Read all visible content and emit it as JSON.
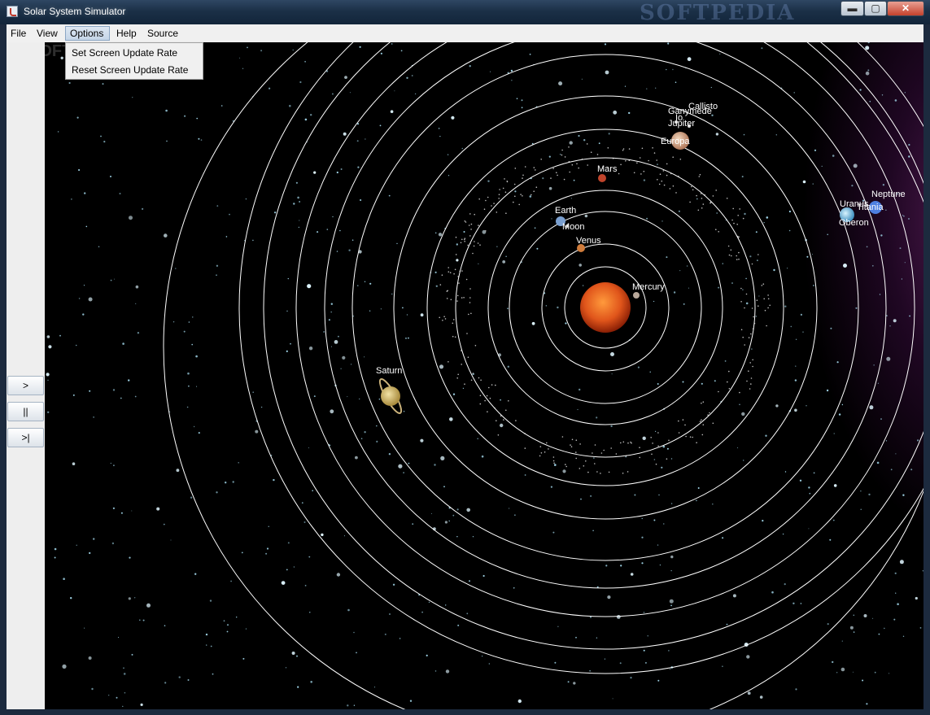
{
  "window": {
    "title": "Solar System Simulator",
    "watermark": "SOFTPEDIA",
    "minimize_glyph": "▬",
    "maximize_glyph": "▢",
    "close_glyph": "✕"
  },
  "menubar": {
    "items": [
      {
        "label": "File"
      },
      {
        "label": "View"
      },
      {
        "label": "Options",
        "open": true
      },
      {
        "label": "Help"
      },
      {
        "label": "Source"
      }
    ]
  },
  "options_menu": {
    "items": [
      {
        "label": "Set Screen Update Rate"
      },
      {
        "label": "Reset Screen Update Rate"
      }
    ]
  },
  "controls": {
    "play_label": ">",
    "pause_label": "||",
    "step_label": ">|"
  },
  "canvas": {
    "watermark": "SOFTPEDIA",
    "colors": {
      "background": "#000000",
      "orbit": "#ffffff",
      "sun": "#e0551b",
      "nebula": "#8a2d8c"
    },
    "labels": {
      "mercury": "Mercury",
      "venus": "Venus",
      "earth": "Earth",
      "moon": "Moon",
      "mars": "Mars",
      "jupiter": "Jupiter",
      "europa": "Europa",
      "io": "Io",
      "ganymede": "Ganymede",
      "callisto": "Callisto",
      "saturn": "Saturn",
      "uranus": "Uranus",
      "neptune": "Neptune",
      "titania": "Titania",
      "oberon": "Oberon"
    }
  }
}
